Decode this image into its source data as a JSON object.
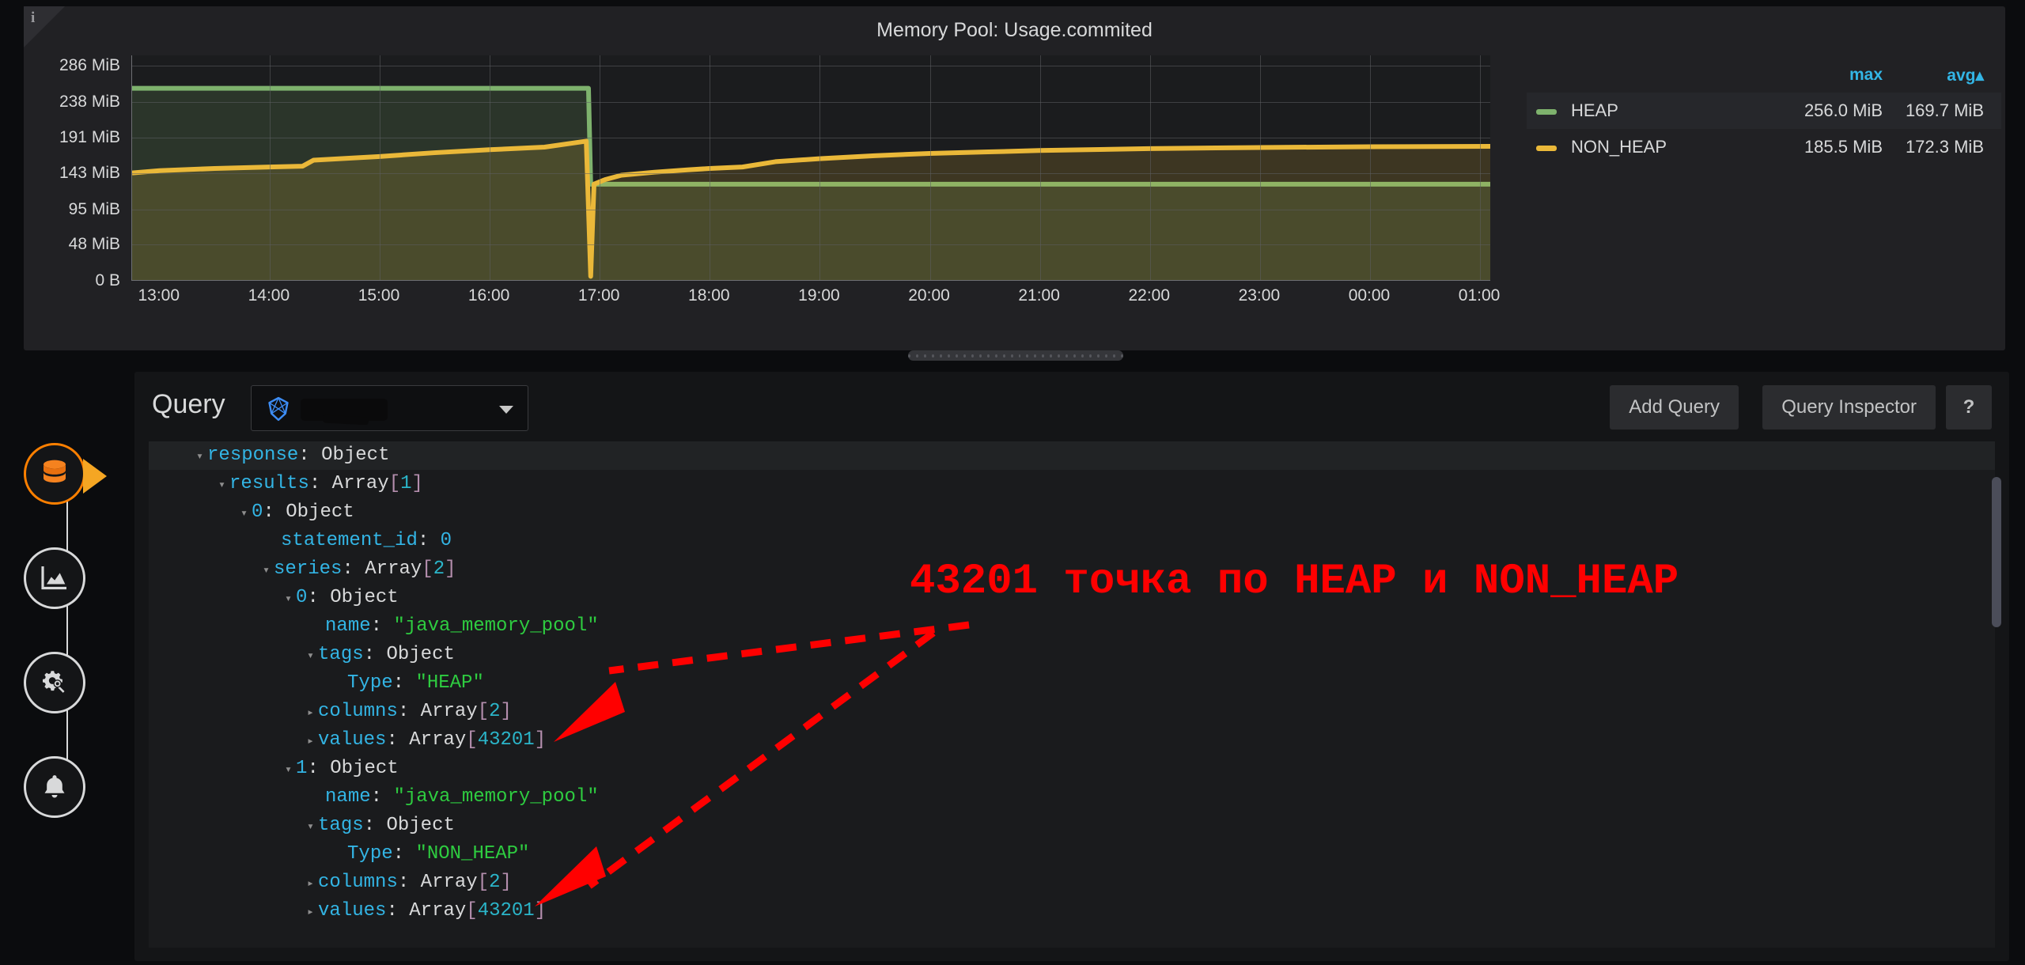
{
  "panel": {
    "title": "Memory Pool: Usage.commited",
    "info_icon": "info-icon",
    "info_glyph": "i"
  },
  "legend": {
    "columns": [
      "max",
      "avg▴"
    ],
    "col_max": "max",
    "col_avg": "avg▴",
    "rows": [
      {
        "name": "HEAP",
        "color": "#7eb26d",
        "max": "256.0 MiB",
        "avg": "169.7 MiB"
      },
      {
        "name": "NON_HEAP",
        "color": "#eab839",
        "max": "185.5 MiB",
        "avg": "172.3 MiB"
      }
    ]
  },
  "chart_data": {
    "type": "line",
    "title": "Memory Pool: Usage.commited",
    "xlabel": "",
    "ylabel": "",
    "grid": true,
    "legend_position": "right",
    "ylim": [
      0,
      300
    ],
    "ytick_labels": [
      "0 B",
      "48 MiB",
      "95 MiB",
      "143 MiB",
      "191 MiB",
      "238 MiB",
      "286 MiB"
    ],
    "ytick_values": [
      0,
      48,
      95,
      143,
      191,
      238,
      286
    ],
    "xtick_labels": [
      "13:00",
      "14:00",
      "15:00",
      "16:00",
      "17:00",
      "18:00",
      "19:00",
      "20:00",
      "21:00",
      "22:00",
      "23:00",
      "00:00",
      "01:00"
    ],
    "x_unit": "hours",
    "series": [
      {
        "name": "HEAP",
        "color": "#7eb26d",
        "fill": true,
        "x": [
          12.75,
          16.9,
          16.92,
          25.1
        ],
        "values": [
          256.0,
          256.0,
          128.0,
          128.0
        ]
      },
      {
        "name": "NON_HEAP",
        "color": "#eab839",
        "fill": true,
        "x": [
          12.75,
          13.0,
          13.5,
          14.0,
          14.3,
          14.4,
          15.0,
          15.5,
          16.0,
          16.5,
          16.88,
          16.92,
          16.95,
          17.05,
          17.2,
          17.5,
          17.8,
          18.0,
          18.3,
          18.6,
          19.0,
          19.5,
          20.0,
          20.5,
          21.0,
          22.0,
          23.0,
          24.0,
          25.1
        ],
        "values": [
          143.0,
          146.0,
          149.0,
          151.0,
          152.0,
          160.0,
          165.0,
          170.0,
          174.0,
          177.5,
          185.5,
          5.0,
          128.0,
          134.0,
          140.0,
          144.0,
          147.0,
          149.0,
          151.0,
          158.0,
          162.0,
          166.0,
          169.0,
          171.0,
          173.0,
          175.5,
          177.0,
          178.0,
          178.5
        ]
      }
    ],
    "annotations": [
      "Application restart near 16:55 resets HEAP committed from 256.0 MiB to 128.0 MiB"
    ]
  },
  "editor": {
    "query_label": "Query",
    "datasource_icon": "influxdb-icon",
    "datasource_value": "",
    "caret_icon": "chevron-down-icon",
    "add_query_label": "Add Query",
    "query_inspector_label": "Query Inspector",
    "help_label": "?"
  },
  "json_tree": [
    {
      "indent": 0,
      "toggle": "▾",
      "key": "response",
      "sep": ": ",
      "type": "Object",
      "count": "",
      "value": "",
      "highlight": true
    },
    {
      "indent": 1,
      "toggle": "▾",
      "key": "results",
      "sep": ": ",
      "type": "Array",
      "count": "1",
      "value": ""
    },
    {
      "indent": 2,
      "toggle": "▾",
      "key": "0",
      "sep": ": ",
      "type": "Object",
      "count": "",
      "value": "",
      "keynum": true
    },
    {
      "indent": 3,
      "toggle": "",
      "key": "statement_id",
      "sep": ": ",
      "type": "",
      "count": "",
      "value": "0",
      "valnum": true
    },
    {
      "indent": 3,
      "toggle": "▾",
      "key": "series",
      "sep": ": ",
      "type": "Array",
      "count": "2",
      "value": ""
    },
    {
      "indent": 4,
      "toggle": "▾",
      "key": "0",
      "sep": ": ",
      "type": "Object",
      "count": "",
      "value": "",
      "keynum": true
    },
    {
      "indent": 5,
      "toggle": "",
      "key": "name",
      "sep": ": ",
      "type": "",
      "count": "",
      "value": "\"java_memory_pool\"",
      "valstr": true
    },
    {
      "indent": 5,
      "toggle": "▾",
      "key": "tags",
      "sep": ": ",
      "type": "Object",
      "count": "",
      "value": ""
    },
    {
      "indent": 6,
      "toggle": "",
      "key": "Type",
      "sep": ": ",
      "type": "",
      "count": "",
      "value": "\"HEAP\"",
      "valstr": true
    },
    {
      "indent": 5,
      "toggle": "▸",
      "key": "columns",
      "sep": ": ",
      "type": "Array",
      "count": "2",
      "value": ""
    },
    {
      "indent": 5,
      "toggle": "▸",
      "key": "values",
      "sep": ": ",
      "type": "Array",
      "count": "43201",
      "value": ""
    },
    {
      "indent": 4,
      "toggle": "▾",
      "key": "1",
      "sep": ": ",
      "type": "Object",
      "count": "",
      "value": "",
      "keynum": true
    },
    {
      "indent": 5,
      "toggle": "",
      "key": "name",
      "sep": ": ",
      "type": "",
      "count": "",
      "value": "\"java_memory_pool\"",
      "valstr": true
    },
    {
      "indent": 5,
      "toggle": "▾",
      "key": "tags",
      "sep": ": ",
      "type": "Object",
      "count": "",
      "value": ""
    },
    {
      "indent": 6,
      "toggle": "",
      "key": "Type",
      "sep": ": ",
      "type": "",
      "count": "",
      "value": "\"NON_HEAP\"",
      "valstr": true
    },
    {
      "indent": 5,
      "toggle": "▸",
      "key": "columns",
      "sep": ": ",
      "type": "Array",
      "count": "2",
      "value": ""
    },
    {
      "indent": 5,
      "toggle": "▸",
      "key": "values",
      "sep": ": ",
      "type": "Array",
      "count": "43201",
      "value": ""
    }
  ],
  "annotation": {
    "text": "43201 точка по HEAP и NON_HEAP",
    "color": "#ff0000"
  },
  "rail": {
    "items": [
      {
        "name": "queries",
        "icon": "database-icon",
        "active": true
      },
      {
        "name": "visualization",
        "icon": "chart-area-icon",
        "active": false
      },
      {
        "name": "general",
        "icon": "gear-wrench-icon",
        "active": false
      },
      {
        "name": "alert",
        "icon": "bell-icon",
        "active": false
      }
    ]
  }
}
